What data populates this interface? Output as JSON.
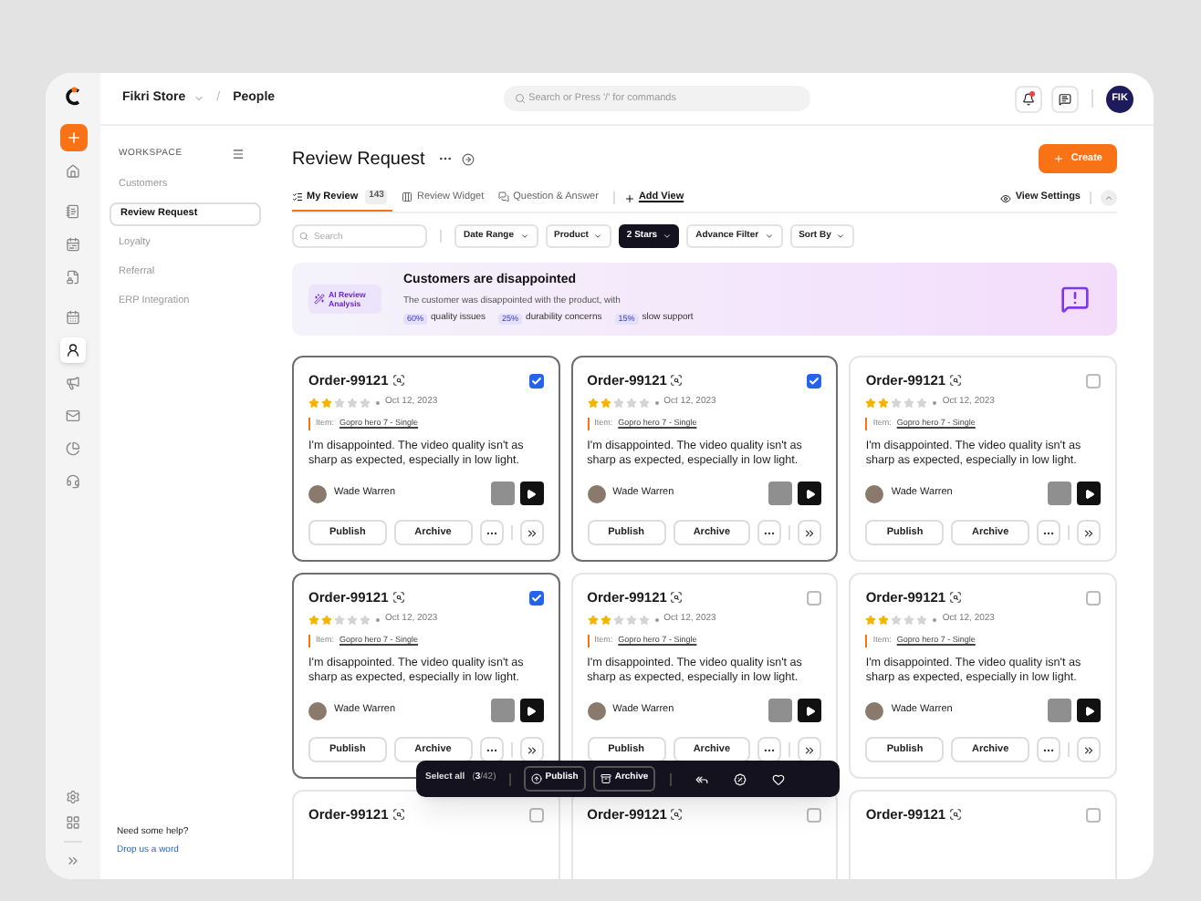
{
  "topbar": {
    "store": "Fikri Store",
    "separator": "/",
    "page": "People",
    "search_placeholder": "Search or Press '/' for commands",
    "notification": true,
    "avatar": "FIK"
  },
  "rail": {
    "items": [
      {
        "selected": false
      },
      {
        "selected": false
      },
      {
        "selected": false
      },
      {
        "selected": false
      },
      {
        "selected": false
      },
      {
        "selected": true
      },
      {
        "selected": false
      },
      {
        "selected": false
      },
      {
        "selected": false
      },
      {
        "selected": false
      }
    ]
  },
  "sidebar": {
    "heading": "WORKSPACE",
    "items": [
      {
        "label": "Customers",
        "selected": false
      },
      {
        "label": "Review Request",
        "selected": true
      },
      {
        "label": "Loyalty",
        "selected": false
      },
      {
        "label": "Referral",
        "selected": false
      },
      {
        "label": "ERP Integration",
        "selected": false
      }
    ],
    "help": "Need some help?",
    "help_link": "Drop us a word"
  },
  "header": {
    "title": "Review Request",
    "create": "Create"
  },
  "tabs": [
    {
      "label": "My Review",
      "count": "143",
      "selected": true
    },
    {
      "label": "Review Widget",
      "selected": false
    },
    {
      "label": "Question & Answer",
      "selected": false
    }
  ],
  "add_view": "Add View",
  "view_settings": "View Settings",
  "filters": {
    "search_placeholder": "Search",
    "items": [
      {
        "label": "Date Range",
        "active": false
      },
      {
        "label": "Product",
        "active": false
      },
      {
        "label": "2 Stars",
        "active": true
      },
      {
        "label": "Advance Filter",
        "active": false
      },
      {
        "label": "Sort By",
        "active": false
      }
    ]
  },
  "banner": {
    "badge": "AI Review Analysis",
    "title": "Customers are disappointed",
    "text": "The customer was disappointed with the product, with",
    "stats": [
      {
        "value": "60%",
        "label": "quality issues"
      },
      {
        "value": "25%",
        "label": "durability concerns"
      },
      {
        "value": "15%",
        "label": "slow support"
      }
    ]
  },
  "cards": [
    {
      "order": "Order-99121",
      "selected": true,
      "stars": 2,
      "date": "Oct 12, 2023",
      "item_label": "Item:",
      "item": "Gopro hero 7 - Single",
      "text": "I'm disappointed. The video quality isn't as sharp as expected, especially in low light.",
      "author": "Wade Warren",
      "publish": "Publish",
      "archive": "Archive"
    },
    {
      "order": "Order-99121",
      "selected": true,
      "stars": 2,
      "date": "Oct 12, 2023",
      "item_label": "Item:",
      "item": "Gopro hero 7 - Single",
      "text": "I'm disappointed. The video quality isn't as sharp as expected, especially in low light.",
      "author": "Wade Warren",
      "publish": "Publish",
      "archive": "Archive"
    },
    {
      "order": "Order-99121",
      "selected": false,
      "stars": 2,
      "date": "Oct 12, 2023",
      "item_label": "Item:",
      "item": "Gopro hero 7 - Single",
      "text": "I'm disappointed. The video quality isn't as sharp as expected, especially in low light.",
      "author": "Wade Warren",
      "publish": "Publish",
      "archive": "Archive"
    },
    {
      "order": "Order-99121",
      "selected": true,
      "stars": 2,
      "date": "Oct 12, 2023",
      "item_label": "Item:",
      "item": "Gopro hero 7 - Single",
      "text": "I'm disappointed. The video quality isn't as sharp as expected, especially in low light.",
      "author": "Wade Warren",
      "publish": "Publish",
      "archive": "Archive"
    },
    {
      "order": "Order-99121",
      "selected": false,
      "stars": 2,
      "date": "Oct 12, 2023",
      "item_label": "Item:",
      "item": "Gopro hero 7 - Single",
      "text": "I'm disappointed. The video quality isn't as sharp as expected, especially in low light.",
      "author": "Wade Warren",
      "publish": "Publish",
      "archive": "Archive"
    },
    {
      "order": "Order-99121",
      "selected": false,
      "stars": 2,
      "date": "Oct 12, 2023",
      "item_label": "Item:",
      "item": "Gopro hero 7 - Single",
      "text": "I'm disappointed. The video quality isn't as sharp as expected, especially in low light.",
      "author": "Wade Warren",
      "publish": "Publish",
      "archive": "Archive"
    },
    {
      "order": "Order-99121",
      "selected": false
    },
    {
      "order": "Order-99121",
      "selected": false
    },
    {
      "order": "Order-99121",
      "selected": false
    }
  ],
  "bulk_bar": {
    "select_all": "Select all",
    "count": "(**3**/42)",
    "publish": "Publish",
    "archive": "Archive"
  }
}
